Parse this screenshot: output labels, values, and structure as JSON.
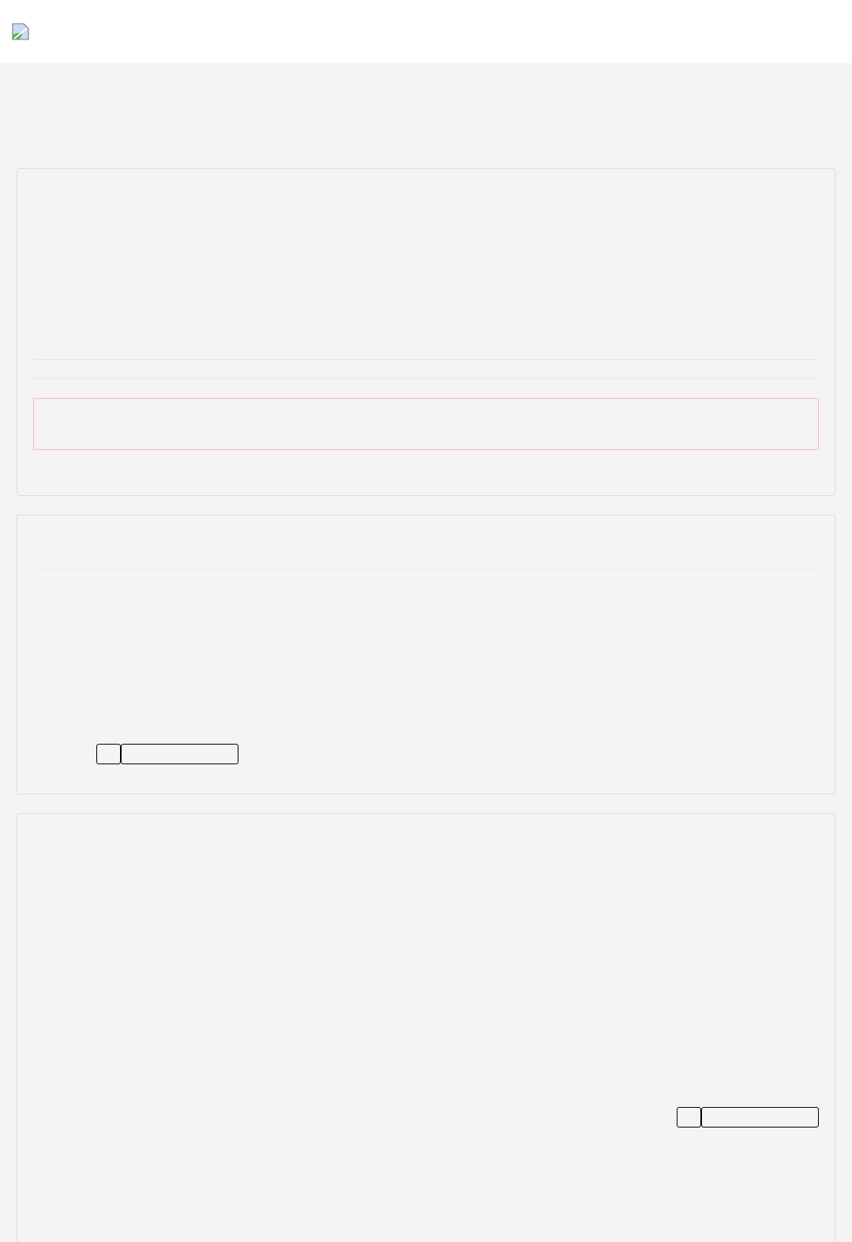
{
  "header": {
    "logo": {
      "kind": "broken-image"
    }
  },
  "panels": [
    {
      "kind": "alert"
    },
    {
      "kind": "controls-left"
    },
    {
      "kind": "controls-right"
    }
  ]
}
